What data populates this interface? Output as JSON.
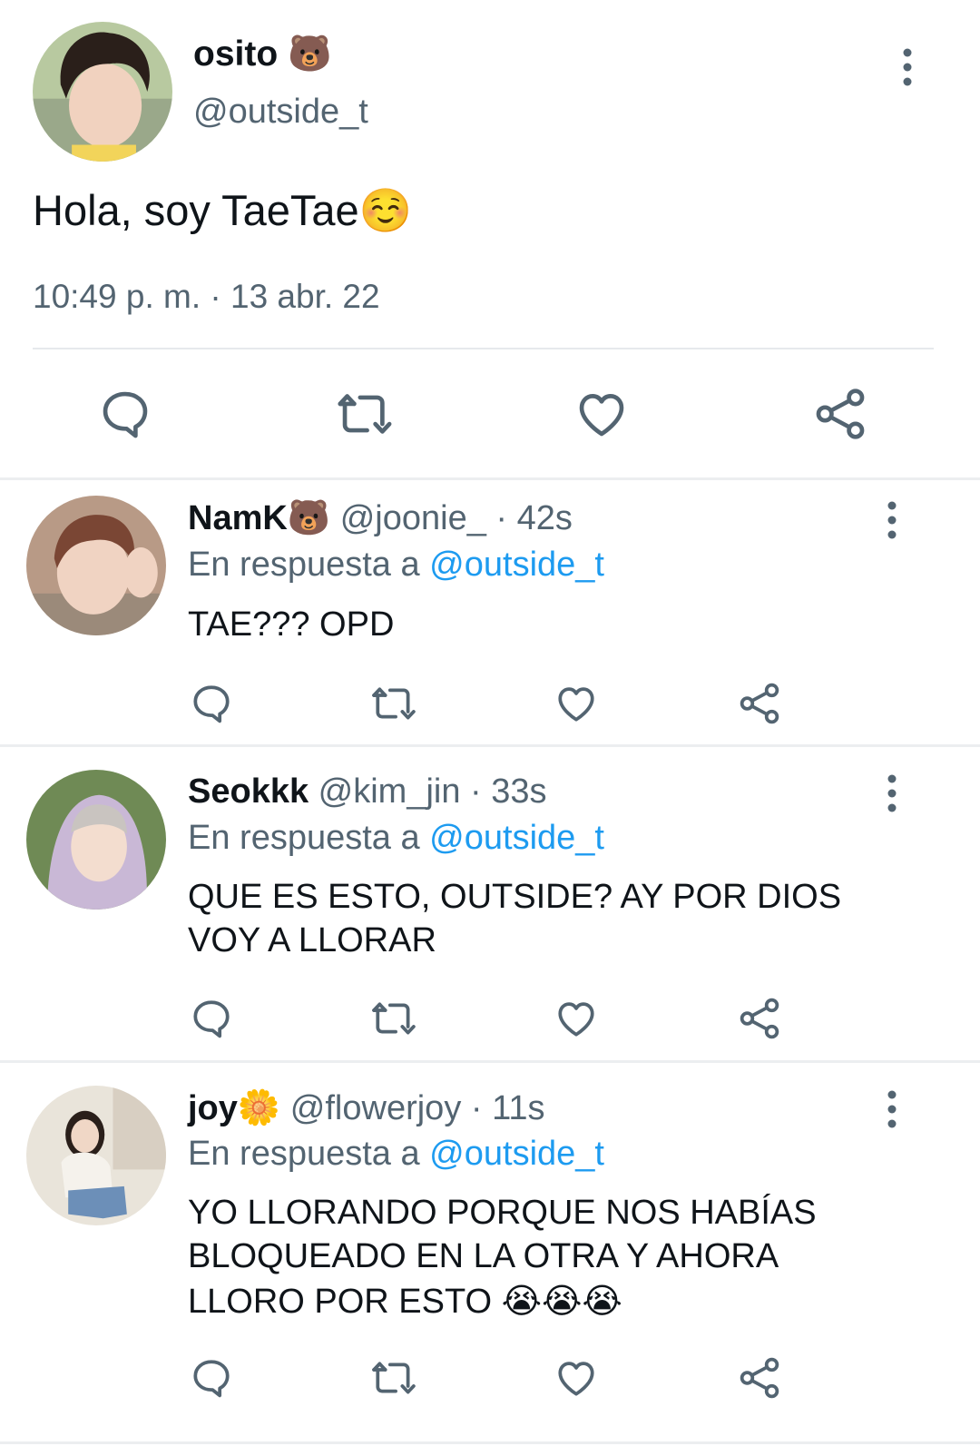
{
  "main_tweet": {
    "display_name": "osito",
    "name_emoji": "🐻",
    "handle": "@outside_t",
    "text": "Hola, soy TaeTae",
    "text_emoji": "☺️",
    "timestamp": "10:49 p. m. · 13 abr. 22"
  },
  "replies": [
    {
      "display_name": "NamK",
      "name_emoji": "🐻",
      "handle": "@joonie_",
      "time": "· 42s",
      "reply_prefix": "En respuesta a",
      "reply_to": "@outside_t",
      "lines": [
        "TAE??? OPD"
      ]
    },
    {
      "display_name": "Seokkk",
      "name_emoji": "",
      "handle": "@kim_jin",
      "time": "· 33s",
      "reply_prefix": "En respuesta a",
      "reply_to": "@outside_t",
      "lines": [
        "QUE ES ESTO, OUTSIDE? AY POR DIOS",
        "VOY A LLORAR"
      ]
    },
    {
      "display_name": "joy",
      "name_emoji": "🌼",
      "handle": "@flowerjoy",
      "time": "· 11s",
      "reply_prefix": "En respuesta a",
      "reply_to": "@outside_t",
      "lines": [
        "YO LLORANDO PORQUE NOS HABÍAS",
        "BLOQUEADO EN LA OTRA Y AHORA",
        "LLORO POR ESTO"
      ],
      "trailing_emoji": "😭😭😭"
    }
  ],
  "icons": [
    "reply-icon",
    "retweet-icon",
    "like-icon",
    "share-icon",
    "more-options-icon"
  ],
  "colors": {
    "text": "#0f1419",
    "muted": "#536471",
    "link": "#1d9bf0",
    "divider": "#eceef0"
  }
}
